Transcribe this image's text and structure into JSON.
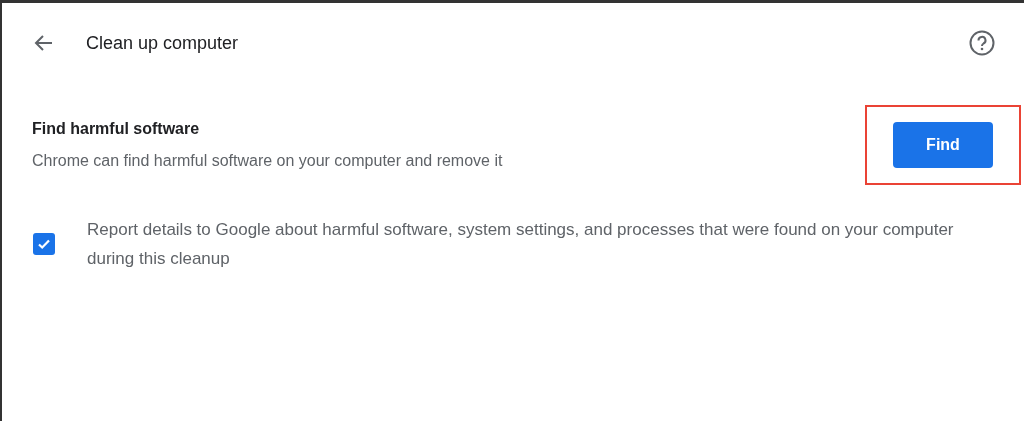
{
  "header": {
    "title": "Clean up computer"
  },
  "section": {
    "title": "Find harmful software",
    "description": "Chrome can find harmful software on your computer and remove it",
    "button": {
      "label": "Find",
      "highlighted": true
    }
  },
  "report_option": {
    "label": "Report details to Google about harmful software, system settings, and processes that were found on your computer during this cleanup",
    "checked": true
  }
}
